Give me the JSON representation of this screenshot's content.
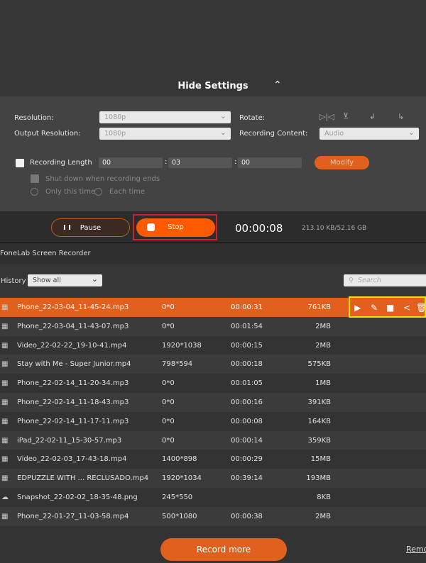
{
  "header": {
    "hide_settings": "Hide Settings",
    "chevron": "chevron-up-icon"
  },
  "settings": {
    "resolution_label": "Resolution:",
    "resolution_value": "1080p",
    "output_resolution_label": "Output Resolution:",
    "output_resolution_value": "1080p",
    "rotate_label": "Rotate:",
    "recording_content_label": "Recording Content:",
    "recording_content_value": "Audio",
    "recording_length_label": "Recording Length",
    "hours": "00",
    "minutes": "03",
    "seconds": "00",
    "sep": ":",
    "modify_label": "Modify",
    "shutdown_label": "Shut down when recording ends",
    "only_this_time": "Only this time",
    "each_time": "Each time"
  },
  "controls": {
    "pause_label": "Pause",
    "stop_label": "Stop",
    "timer": "00:00:08",
    "size": "213.10 KB/52.16 GB"
  },
  "app_title": "FoneLab Screen Recorder",
  "history": {
    "label": "History",
    "filter": "Show all",
    "search_placeholder": "Search"
  },
  "files": [
    {
      "name": "Phone_22-03-04_11-45-24.mp3",
      "res": "0*0",
      "dur": "00:00:31",
      "size": "761KB",
      "icon": "video-icon",
      "selected": true
    },
    {
      "name": "Phone_22-03-04_11-43-07.mp3",
      "res": "0*0",
      "dur": "00:01:54",
      "size": "2MB",
      "icon": "video-icon"
    },
    {
      "name": "Video_22-02-22_19-10-41.mp4",
      "res": "1920*1038",
      "dur": "00:00:15",
      "size": "2MB",
      "icon": "video-icon"
    },
    {
      "name": "Stay with Me - Super Junior.mp4",
      "res": "798*594",
      "dur": "00:00:18",
      "size": "575KB",
      "icon": "video-icon"
    },
    {
      "name": "Phone_22-02-14_11-20-34.mp3",
      "res": "0*0",
      "dur": "00:01:05",
      "size": "1MB",
      "icon": "video-icon"
    },
    {
      "name": "Phone_22-02-14_11-18-43.mp3",
      "res": "0*0",
      "dur": "00:00:16",
      "size": "391KB",
      "icon": "video-icon"
    },
    {
      "name": "Phone_22-02-14_11-17-11.mp3",
      "res": "0*0",
      "dur": "00:00:08",
      "size": "164KB",
      "icon": "video-icon"
    },
    {
      "name": "iPad_22-02-11_15-30-57.mp3",
      "res": "0*0",
      "dur": "00:00:14",
      "size": "359KB",
      "icon": "video-icon"
    },
    {
      "name": "Video_22-02-03_17-43-18.mp4",
      "res": "1400*898",
      "dur": "00:00:29",
      "size": "15MB",
      "icon": "video-icon"
    },
    {
      "name": "EDPUZZLE WITH ... RECLUSADO.mp4",
      "res": "1920*1034",
      "dur": "00:39:14",
      "size": "193MB",
      "icon": "video-icon"
    },
    {
      "name": "Snapshot_22-02-02_18-35-48.png",
      "res": "245*550",
      "dur": "",
      "size": "8KB",
      "icon": "image-icon"
    },
    {
      "name": "Phone_22-01-27_11-03-58.mp4",
      "res": "500*1080",
      "dur": "00:00:38",
      "size": "2MB",
      "icon": "video-icon"
    }
  ],
  "footer": {
    "record_more": "Record more",
    "remove": "Remo"
  },
  "colors": {
    "accent": "#e1601e",
    "stop": "#ff5a00",
    "highlight_stop": "#d0202a",
    "highlight_actions": "#f5e100"
  }
}
